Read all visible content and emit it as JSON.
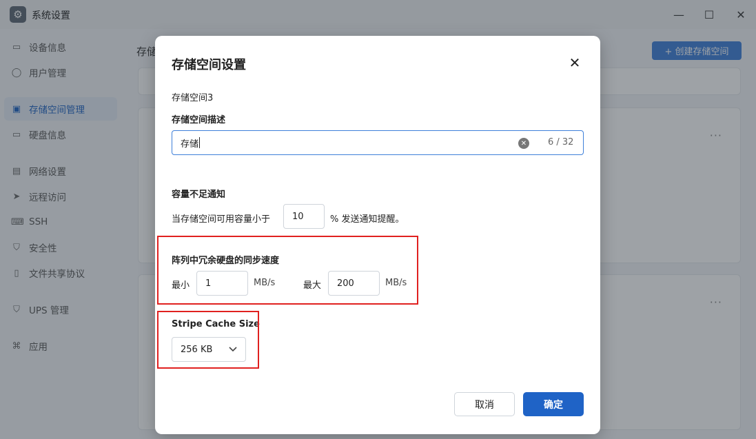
{
  "window": {
    "title": "系统设置",
    "minimize": "—",
    "maximize": "☐",
    "close": "✕"
  },
  "sidebar": {
    "items": [
      {
        "label": "设备信息",
        "icon": "monitor-icon"
      },
      {
        "label": "用户管理",
        "icon": "user-icon"
      },
      {
        "label": "存储空间管理",
        "icon": "storage-icon",
        "active": true
      },
      {
        "label": "硬盘信息",
        "icon": "disk-icon"
      },
      {
        "label": "网络设置",
        "icon": "network-icon"
      },
      {
        "label": "远程访问",
        "icon": "send-icon"
      },
      {
        "label": "SSH",
        "icon": "terminal-icon"
      },
      {
        "label": "安全性",
        "icon": "shield-icon"
      },
      {
        "label": "文件共享协议",
        "icon": "file-icon"
      },
      {
        "label": "UPS 管理",
        "icon": "ups-icon"
      },
      {
        "label": "应用",
        "icon": "apps-icon"
      }
    ]
  },
  "main": {
    "breadcrumb": "存储",
    "create_button": "+ 创建存储空间",
    "more": "···"
  },
  "dialog": {
    "title": "存储空间设置",
    "close": "✕",
    "storage_name": "存储空间3",
    "description_label": "存储空间描述",
    "description_value": "存储",
    "description_counter": "6 / 32",
    "notice_label": "容量不足通知",
    "notice_prefix": "当存储空间可用容量小于",
    "notice_value": "10",
    "notice_suffix": "% 发送通知提醒。",
    "sync_label": "阵列中冗余硬盘的同步速度",
    "min_label": "最小",
    "min_value": "1",
    "max_label": "最大",
    "max_value": "200",
    "unit": "MB/s",
    "stripe_label": "Stripe Cache Size",
    "stripe_value": "256 KB",
    "cancel": "取消",
    "confirm": "确定"
  },
  "colors": {
    "accent": "#1f63c6",
    "highlight": "#e0201f"
  }
}
